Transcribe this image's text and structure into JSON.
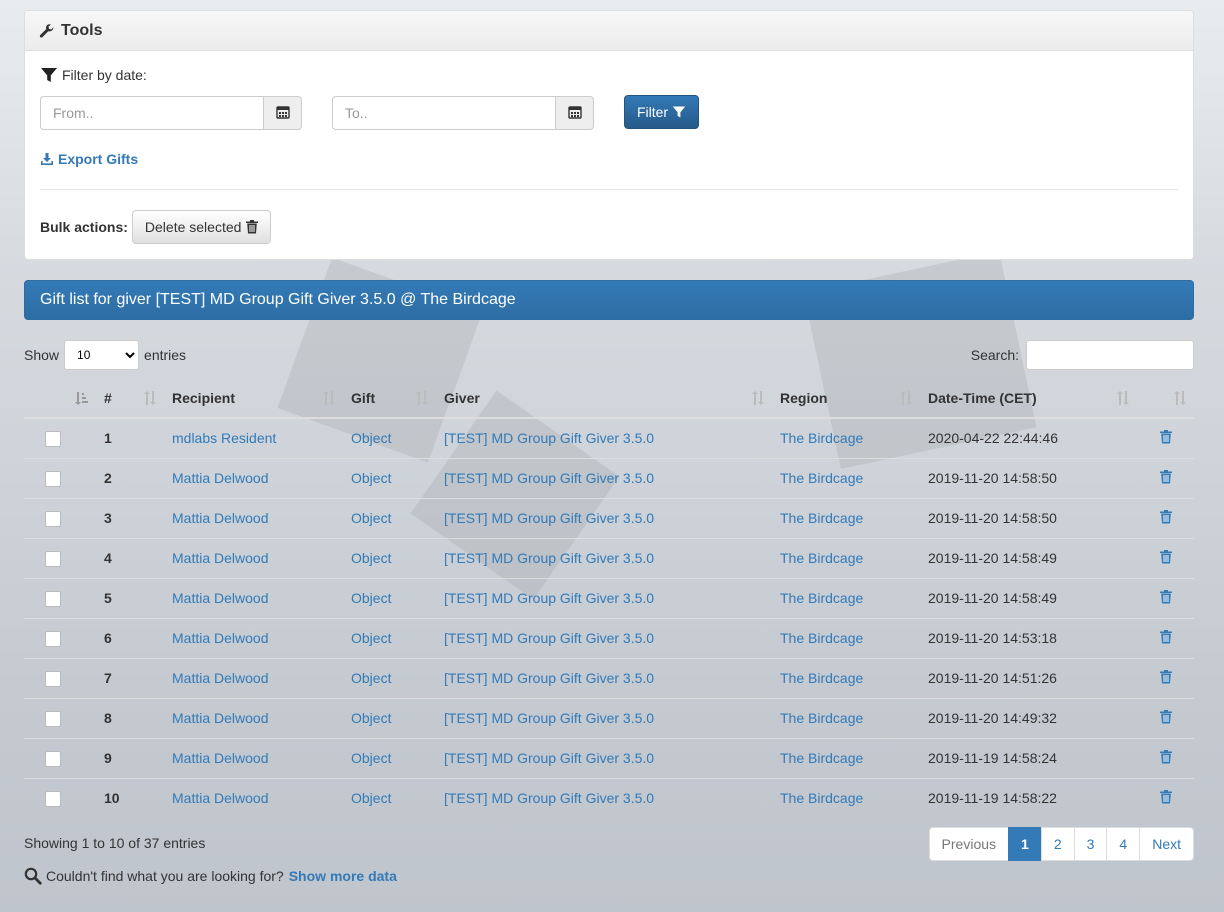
{
  "tools": {
    "title": "Tools",
    "filter_label": "Filter by date:",
    "from_placeholder": "From..",
    "to_placeholder": "To..",
    "filter_button": "Filter",
    "export_label": "Export Gifts",
    "bulk_label": "Bulk actions:",
    "delete_selected": "Delete selected"
  },
  "list": {
    "heading": "Gift list for giver [TEST] MD Group Gift Giver 3.5.0 @ The Birdcage",
    "show_label": "Show",
    "page_size": "10",
    "entries_label": "entries",
    "search_label": "Search:"
  },
  "table": {
    "columns": [
      "#",
      "Recipient",
      "Gift",
      "Giver",
      "Region",
      "Date-Time (CET)"
    ],
    "rows": [
      {
        "num": "1",
        "recipient": "mdlabs Resident",
        "gift": "Object",
        "giver": "[TEST] MD Group Gift Giver 3.5.0",
        "region": "The Birdcage",
        "datetime": "2020-04-22 22:44:46"
      },
      {
        "num": "2",
        "recipient": "Mattia Delwood",
        "gift": "Object",
        "giver": "[TEST] MD Group Gift Giver 3.5.0",
        "region": "The Birdcage",
        "datetime": "2019-11-20 14:58:50"
      },
      {
        "num": "3",
        "recipient": "Mattia Delwood",
        "gift": "Object",
        "giver": "[TEST] MD Group Gift Giver 3.5.0",
        "region": "The Birdcage",
        "datetime": "2019-11-20 14:58:50"
      },
      {
        "num": "4",
        "recipient": "Mattia Delwood",
        "gift": "Object",
        "giver": "[TEST] MD Group Gift Giver 3.5.0",
        "region": "The Birdcage",
        "datetime": "2019-11-20 14:58:49"
      },
      {
        "num": "5",
        "recipient": "Mattia Delwood",
        "gift": "Object",
        "giver": "[TEST] MD Group Gift Giver 3.5.0",
        "region": "The Birdcage",
        "datetime": "2019-11-20 14:58:49"
      },
      {
        "num": "6",
        "recipient": "Mattia Delwood",
        "gift": "Object",
        "giver": "[TEST] MD Group Gift Giver 3.5.0",
        "region": "The Birdcage",
        "datetime": "2019-11-20 14:53:18"
      },
      {
        "num": "7",
        "recipient": "Mattia Delwood",
        "gift": "Object",
        "giver": "[TEST] MD Group Gift Giver 3.5.0",
        "region": "The Birdcage",
        "datetime": "2019-11-20 14:51:26"
      },
      {
        "num": "8",
        "recipient": "Mattia Delwood",
        "gift": "Object",
        "giver": "[TEST] MD Group Gift Giver 3.5.0",
        "region": "The Birdcage",
        "datetime": "2019-11-20 14:49:32"
      },
      {
        "num": "9",
        "recipient": "Mattia Delwood",
        "gift": "Object",
        "giver": "[TEST] MD Group Gift Giver 3.5.0",
        "region": "The Birdcage",
        "datetime": "2019-11-19 14:58:24"
      },
      {
        "num": "10",
        "recipient": "Mattia Delwood",
        "gift": "Object",
        "giver": "[TEST] MD Group Gift Giver 3.5.0",
        "region": "The Birdcage",
        "datetime": "2019-11-19 14:58:22"
      }
    ]
  },
  "footer": {
    "info": "Showing 1 to 10 of 37 entries",
    "pager": [
      "Previous",
      "1",
      "2",
      "3",
      "4",
      "Next"
    ],
    "current_page": "1",
    "not_found": "Couldn't find what you are looking for?",
    "show_more": "Show more data"
  },
  "icons": {
    "tools": "wrench-icon",
    "filter": "filter-icon",
    "calendar": "calendar-icon",
    "export": "download-icon",
    "delete": "trash-icon",
    "sort": "sort-icon",
    "search": "magnifier-icon"
  },
  "colors": {
    "primary": "#337ab7",
    "text": "#333333"
  }
}
